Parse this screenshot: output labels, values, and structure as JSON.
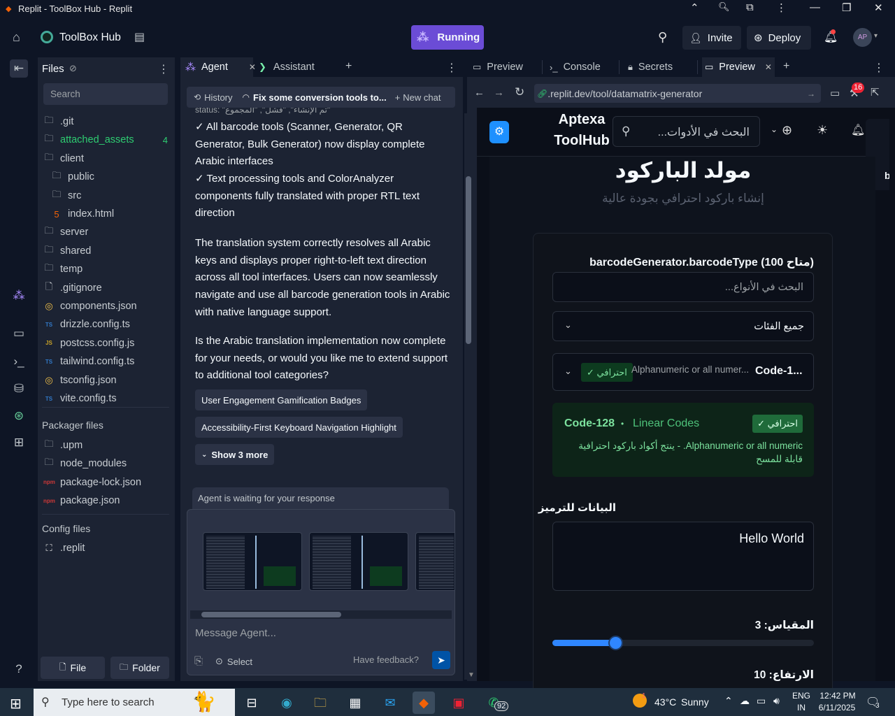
{
  "window": {
    "title": "Replit - ToolBox Hub - Replit"
  },
  "header": {
    "project_name": "ToolBox Hub",
    "run_label": "Running",
    "invite_label": "Invite",
    "deploy_label": "Deploy",
    "avatar": "AP"
  },
  "files": {
    "title": "Files",
    "search_placeholder": "Search",
    "items": [
      {
        "name": ".git",
        "icon": "folder-icon"
      },
      {
        "name": "attached_assets",
        "icon": "folder-icon",
        "badge": "4"
      },
      {
        "name": "client",
        "icon": "folder-icon"
      },
      {
        "name": "public",
        "icon": "folder-icon"
      },
      {
        "name": "src",
        "icon": "folder-icon"
      },
      {
        "name": "index.html",
        "icon": "html-file-icon"
      },
      {
        "name": "server",
        "icon": "folder-icon"
      },
      {
        "name": "shared",
        "icon": "folder-icon"
      },
      {
        "name": "temp",
        "icon": "folder-icon"
      },
      {
        "name": ".gitignore",
        "icon": "file-icon"
      },
      {
        "name": "components.json",
        "icon": "json-file-icon"
      },
      {
        "name": "drizzle.config.ts",
        "icon": "ts-file-icon"
      },
      {
        "name": "postcss.config.js",
        "icon": "js-file-icon"
      },
      {
        "name": "tailwind.config.ts",
        "icon": "ts-file-icon"
      },
      {
        "name": "tsconfig.json",
        "icon": "json-file-icon"
      },
      {
        "name": "vite.config.ts",
        "icon": "ts-file-icon"
      }
    ],
    "packager_title": "Packager files",
    "packager_items": [
      {
        "name": ".upm",
        "icon": "folder-icon"
      },
      {
        "name": "node_modules",
        "icon": "folder-icon"
      },
      {
        "name": "package-lock.json",
        "icon": "npm-file-icon"
      },
      {
        "name": "package.json",
        "icon": "npm-file-icon"
      }
    ],
    "config_title": "Config files",
    "config_items": [
      {
        "name": ".replit",
        "icon": "replit-file-icon"
      }
    ],
    "new_file_label": "File",
    "new_folder_label": "Folder"
  },
  "agent": {
    "tab_agent": "Agent",
    "tab_assistant": "Assistant",
    "history_label": "History",
    "chat_title": "Fix some conversion tools to...",
    "new_chat_label": "New chat",
    "cutoff_line": "status: \"تم الإنشاء\", \"فشل\", \"المجموع\"",
    "msg1": "✓ All barcode tools (Scanner, Generator, QR Generator, Bulk Generator) now display complete Arabic interfaces",
    "msg2": "✓ Text processing tools and ColorAnalyzer components fully translated with proper RTL text direction",
    "msg3": "The translation system correctly resolves all Arabic keys and displays proper right-to-left text direction across all tool interfaces. Users can now seamlessly navigate and use all barcode generation tools in Arabic with native language support.",
    "msg4": "Is the Arabic translation implementation now complete for your needs, or would you like me to extend support to additional tool categories?",
    "suggestion1": "User Engagement Gamification Badges",
    "suggestion2": "Accessibility-First Keyboard Navigation Highlight",
    "show_more": "Show 3 more",
    "waiting": "Agent is waiting for your response",
    "input_placeholder": "Message Agent...",
    "select_label": "Select",
    "feedback_label": "Have feedback?"
  },
  "preview": {
    "tabs": [
      "Preview",
      "Console",
      "Secrets",
      "Preview"
    ],
    "url": ".replit.dev/tool/datamatrix-generator",
    "notif_count": "16"
  },
  "site": {
    "brand_line1": "Aptexa",
    "brand_line2": "ToolHub",
    "search_placeholder": "البحث في الأدوات...",
    "page_title": "مولد الباركود",
    "page_subtitle": "إنشاء باركود احترافي بجودة عالية",
    "type_label": "barcodeGenerator.barcodeType (100 متاح)",
    "type_search_placeholder": "البحث في الأنواع...",
    "category_select": "جميع الفئات",
    "selected_type_name": "Code-1...",
    "selected_type_desc": "Alphanumeric or all numer...",
    "pro_badge": "✓ احترافي",
    "info_name": "Code-128",
    "info_category": "Linear Codes",
    "info_desc": "Alphanumeric or all numeric. - ينتج أكواد باركود احترافية قابلة للمسح",
    "data_label": "البيانات للترميز",
    "data_value": "Hello World",
    "scale_label": "المقياس: 3",
    "scale_fraction": 0.24,
    "height_label": "الارتفاع: 10",
    "side_letter": "b"
  },
  "taskbar": {
    "search_placeholder": "Type here to search",
    "whatsapp_badge": "92",
    "weather_temp": "43°C",
    "weather_text": "Sunny",
    "weather_alert": "1",
    "lang_top": "ENG",
    "lang_bottom": "IN",
    "time": "12:42 PM",
    "date": "6/11/2025",
    "notif_count": "3"
  },
  "colors": {
    "accent": "#6b4cd6",
    "bg": "#0e1525",
    "panel": "#1c2333",
    "green": "#2ecc71",
    "slider": "#2f86ff"
  }
}
